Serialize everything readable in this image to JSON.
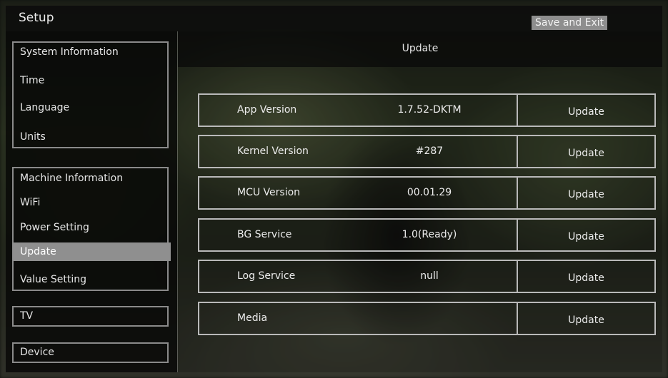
{
  "header": {
    "title": "Setup",
    "save_label": "Save and Exit"
  },
  "sidebar": {
    "groups": [
      {
        "items": [
          "System Information",
          "Time",
          "Language",
          "Units"
        ]
      },
      {
        "items": [
          "Machine Information",
          "WiFi",
          "Power Setting",
          "Update",
          "Value Setting"
        ],
        "selected": "Update"
      },
      {
        "items": [
          "TV"
        ]
      },
      {
        "items": [
          "Device"
        ]
      }
    ]
  },
  "main": {
    "title": "Update",
    "rows": [
      {
        "label": "App Version",
        "value": "1.7.52-DKTM",
        "button": "Update"
      },
      {
        "label": "Kernel Version",
        "value": "#287",
        "button": "Update"
      },
      {
        "label": "MCU Version",
        "value": "00.01.29",
        "button": "Update"
      },
      {
        "label": "BG Service",
        "value": "1.0(Ready)",
        "button": "Update"
      },
      {
        "label": "Log Service",
        "value": "null",
        "button": "Update"
      },
      {
        "label": "Media",
        "value": "",
        "button": "Update"
      }
    ]
  },
  "colors": {
    "selected_bg": "#8f8f8f",
    "border": "#b9b9b9",
    "save_bg": "#8e8e8e"
  }
}
